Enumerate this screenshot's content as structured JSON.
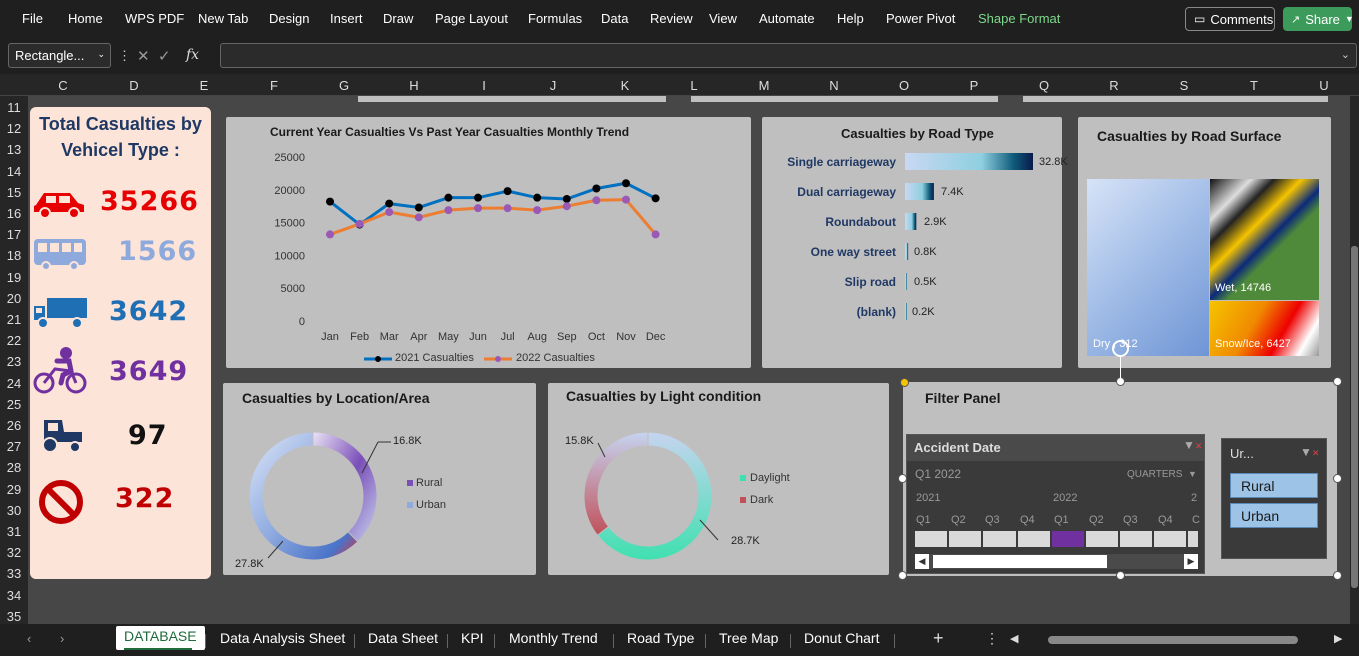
{
  "menu": {
    "items": [
      "File",
      "Home",
      "WPS PDF",
      "New Tab",
      "Design",
      "Insert",
      "Draw",
      "Page Layout",
      "Formulas",
      "Data",
      "Review",
      "View",
      "Automate",
      "Help",
      "Power Pivot",
      "Shape Format"
    ],
    "comments": "Comments",
    "share": "Share"
  },
  "formula": {
    "namebox": "Rectangle...",
    "fx": "fx"
  },
  "columns": [
    "C",
    "D",
    "E",
    "F",
    "G",
    "H",
    "I",
    "J",
    "K",
    "L",
    "M",
    "N",
    "O",
    "P",
    "Q",
    "R",
    "S",
    "T",
    "U"
  ],
  "rows": [
    "11",
    "12",
    "13",
    "14",
    "15",
    "16",
    "17",
    "18",
    "19",
    "20",
    "21",
    "22",
    "23",
    "24",
    "25",
    "26",
    "27",
    "28",
    "29",
    "30",
    "31",
    "32",
    "33",
    "34",
    "35"
  ],
  "vehicles": {
    "title_line1": "Total Casualties by",
    "title_line2": "Vehicel Type :",
    "items": [
      {
        "icon": "car-icon",
        "value": "35266",
        "color": "#e60000"
      },
      {
        "icon": "bus-icon",
        "value": "1566",
        "color": "#8ea9db"
      },
      {
        "icon": "truck-icon",
        "value": "3642",
        "color": "#1f6fb5"
      },
      {
        "icon": "bicycle-icon",
        "value": "3649",
        "color": "#7030a0"
      },
      {
        "icon": "tractor-icon",
        "value": "97",
        "color": "#111111"
      },
      {
        "icon": "prohibited-icon",
        "value": "322",
        "color": "#c00000"
      }
    ]
  },
  "trend": {
    "title": "Current Year Casualties Vs Past Year Casualties Monthly Trend",
    "legend1": "2021 Casualties",
    "legend2": "2022 Casualties",
    "yticks": [
      "25000",
      "20000",
      "15000",
      "10000",
      "5000",
      "0"
    ]
  },
  "roadtype": {
    "title": "Casualties by Road Type",
    "items": [
      {
        "label": "Single carriageway",
        "value": "32.8K",
        "num": 32.8
      },
      {
        "label": "Dual carriageway",
        "value": "7.4K",
        "num": 7.4
      },
      {
        "label": "Roundabout",
        "value": "2.9K",
        "num": 2.9
      },
      {
        "label": "One way street",
        "value": "0.8K",
        "num": 0.8
      },
      {
        "label": "Slip road",
        "value": "0.5K",
        "num": 0.5
      },
      {
        "label": "(blank)",
        "value": "0.2K",
        "num": 0.2
      }
    ]
  },
  "surface": {
    "title": "Casualties by Road Surface",
    "dry": "Dry , 312",
    "wet": "Wet, 14746",
    "snow": "Snow/Ice, 6427"
  },
  "location": {
    "title": "Casualties by Location/Area",
    "rural_val": "16.8K",
    "urban_val": "27.8K",
    "legend_rural": "Rural",
    "legend_urban": "Urban"
  },
  "light": {
    "title": "Casualties by Light condition",
    "dark_val": "15.8K",
    "day_val": "28.7K",
    "legend_day": "Daylight",
    "legend_dark": "Dark"
  },
  "filter": {
    "title": "Filter Panel",
    "timeline_title": "Accident Date",
    "period": "Q1 2022",
    "level": "QUARTERS",
    "year1": "2021",
    "year2": "2022",
    "year3": "2",
    "quarters": [
      "Q1",
      "Q2",
      "Q3",
      "Q4",
      "Q1",
      "Q2",
      "Q3",
      "Q4",
      "C"
    ],
    "slicer_title": "Ur...",
    "slicer_items": [
      "Rural",
      "Urban"
    ]
  },
  "sheets": [
    "DATABASE",
    "Data Analysis Sheet",
    "Data Sheet",
    "KPI",
    "Monthly Trend",
    "Road Type",
    "Tree Map",
    "Donut Chart"
  ],
  "chart_data": [
    {
      "type": "line",
      "title": "Current Year Casualties Vs Past Year Casualties Monthly Trend",
      "categories": [
        "Jan",
        "Feb",
        "Mar",
        "Apr",
        "May",
        "Jun",
        "Jul",
        "Aug",
        "Sep",
        "Oct",
        "Nov",
        "Dec"
      ],
      "ylim": [
        0,
        25000
      ],
      "grid": false,
      "legend": "bottom",
      "series": [
        {
          "name": "2021 Casualties",
          "color": "#0070c0",
          "values": [
            18200,
            14700,
            17900,
            17300,
            18800,
            18800,
            19800,
            18800,
            18600,
            20200,
            21000,
            18700
          ]
        },
        {
          "name": "2022 Casualties",
          "color": "#ed7d31",
          "values": [
            13200,
            14800,
            16600,
            15800,
            16900,
            17200,
            17200,
            16900,
            17500,
            18400,
            18500,
            13200
          ]
        }
      ]
    },
    {
      "type": "bar",
      "title": "Casualties by Road Type",
      "categories": [
        "Single carriageway",
        "Dual carriageway",
        "Roundabout",
        "One way street",
        "Slip road",
        "(blank)"
      ],
      "values": [
        32.8,
        7.4,
        2.9,
        0.8,
        0.5,
        0.2
      ]
    },
    {
      "type": "pie",
      "title": "Casualties by Location/Area",
      "categories": [
        "Rural",
        "Urban"
      ],
      "values": [
        16.8,
        27.8
      ]
    },
    {
      "type": "pie",
      "title": "Casualties by Light condition",
      "categories": [
        "Daylight",
        "Dark"
      ],
      "values": [
        28.7,
        15.8
      ]
    }
  ]
}
